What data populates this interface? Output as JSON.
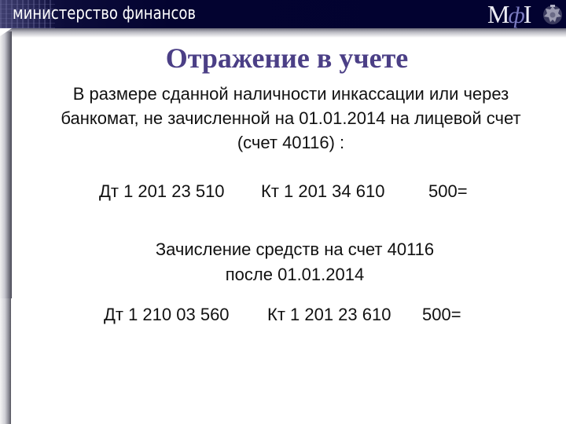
{
  "header": {
    "organization": "министерство финансов",
    "logo": {
      "left": "М",
      "middle": "ф",
      "right": "I"
    },
    "emblem_icon": "coat-of-arms-icon"
  },
  "slide": {
    "title": "Отражение в учете",
    "intro_lines": [
      "В размере сданной наличности инкассации или через",
      "банкомат, не зачисленной на 01.01.2014 на лицевой счет",
      "(счет 40116) :"
    ],
    "entry1": {
      "debit": "Дт 1 201 23 510",
      "credit": "Кт 1 201 34 610",
      "amount": "500="
    },
    "subheading_lines": [
      "Зачисление средств на счет 40116",
      "после 01.01.2014"
    ],
    "entry2": {
      "debit": "Дт 1 210 03 560",
      "credit": "Кт 1 201 23 610",
      "amount": "500="
    }
  },
  "colors": {
    "header_bg": "#020230",
    "title": "#4b3f86",
    "text": "#111111"
  }
}
